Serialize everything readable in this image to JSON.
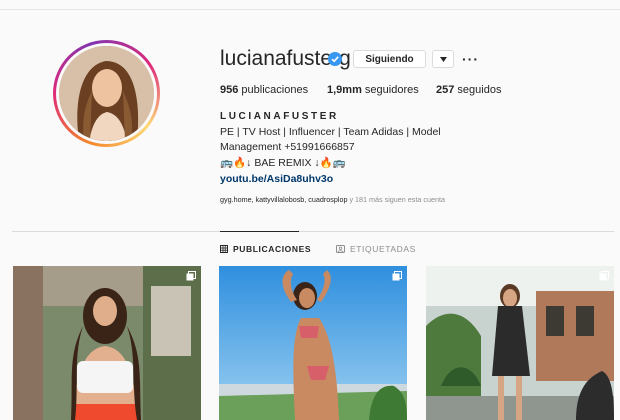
{
  "profile": {
    "username": "lucianafusterg",
    "follow_button": "Siguiendo",
    "dropdown_icon": "caret-down-icon",
    "more_icon": "ellipsis-icon",
    "more_glyph": "···",
    "verified_color": "#3897f0"
  },
  "stats": {
    "posts_count": "956",
    "posts_label": "publicaciones",
    "followers_count": "1,9mm",
    "followers_label": "seguidores",
    "following_count": "257",
    "following_label": "seguidos"
  },
  "bio": {
    "full_name": "LUCIANAFUSTER",
    "line1": "PE | TV Host | Influencer | Team Adidas | Model",
    "line2": "Management +51991666857",
    "line3": "🚌🔥↓ BAE REMIX ↓🔥🚌",
    "link": "youtu.be/AsiDa8uhv3o"
  },
  "followed_by": {
    "names": "gyg.home, kattyvillalobosb, cuadrosplop",
    "rest": "y 181 más siguen esta cuenta"
  },
  "tabs": [
    {
      "label": "PUBLICACIONES",
      "icon": "grid-icon",
      "active": true
    },
    {
      "label": "ETIQUETADAS",
      "icon": "tag-icon",
      "active": false
    }
  ],
  "posts": [
    {
      "icon": "multiple-photos-icon"
    },
    {
      "icon": "multiple-photos-icon"
    },
    {
      "icon": "multiple-photos-icon"
    }
  ]
}
